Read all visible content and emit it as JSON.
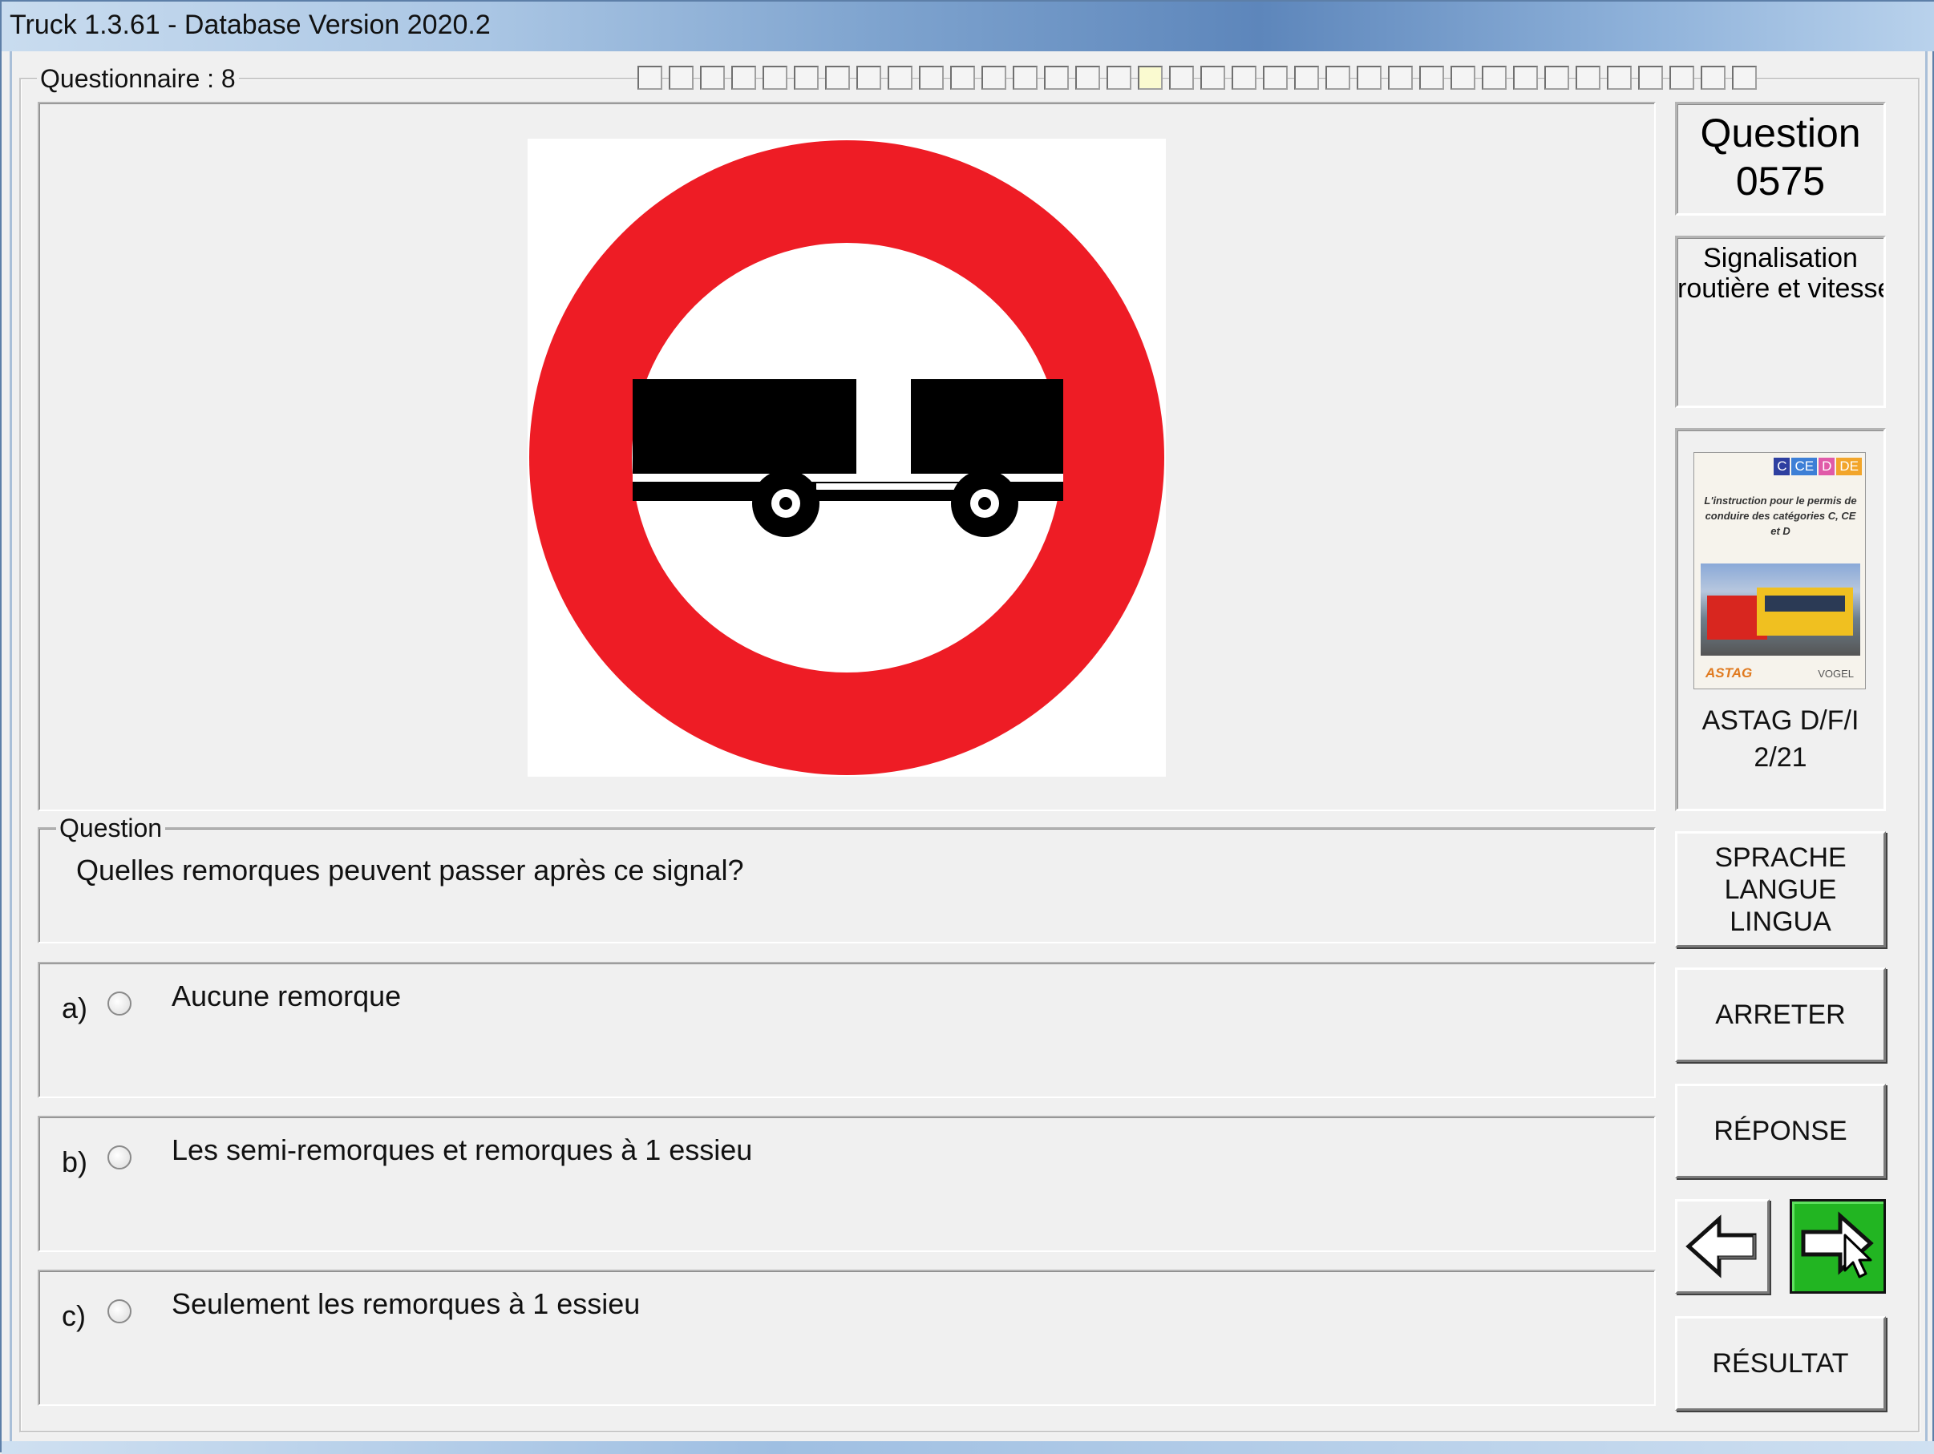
{
  "window": {
    "title": "Truck 1.3.61 - Database Version 2020.2"
  },
  "questionnaire": {
    "label": "Questionnaire : 8",
    "progress_total": 36,
    "progress_current": 16
  },
  "question_panel": {
    "title_line1": "Question",
    "title_line2": "0575",
    "category_line1": "Signalisation",
    "category_line2": "routière et vitesse"
  },
  "reference": {
    "line1": "ASTAG D/F/I",
    "line2": "2/21",
    "book_badges": [
      "C",
      "CE",
      "D",
      "DE"
    ],
    "book_title": "L'instruction pour le permis de conduire des catégories C, CE et D",
    "publisher_left": "ASTAG",
    "publisher_right": "VOGEL"
  },
  "question": {
    "legend": "Question",
    "text": "Quelles remorques peuvent passer après ce signal?"
  },
  "answers": [
    {
      "letter": "a)",
      "text": "Aucune remorque"
    },
    {
      "letter": "b)",
      "text": "Les semi-remorques et remorques à 1 essieu"
    },
    {
      "letter": "c)",
      "text": "Seulement les remorques à 1 essieu"
    }
  ],
  "buttons": {
    "language": "SPRACHE\nLANGUE\nLINGUA",
    "stop": "ARRETER",
    "answer": "RÉPONSE",
    "result": "RÉSULTAT"
  },
  "colors": {
    "sign_red": "#ee1c25",
    "next_green": "#22b522"
  },
  "icons": {
    "prev": "arrow-left-icon",
    "next": "arrow-right-icon",
    "cursor": "mouse-pointer-icon"
  }
}
